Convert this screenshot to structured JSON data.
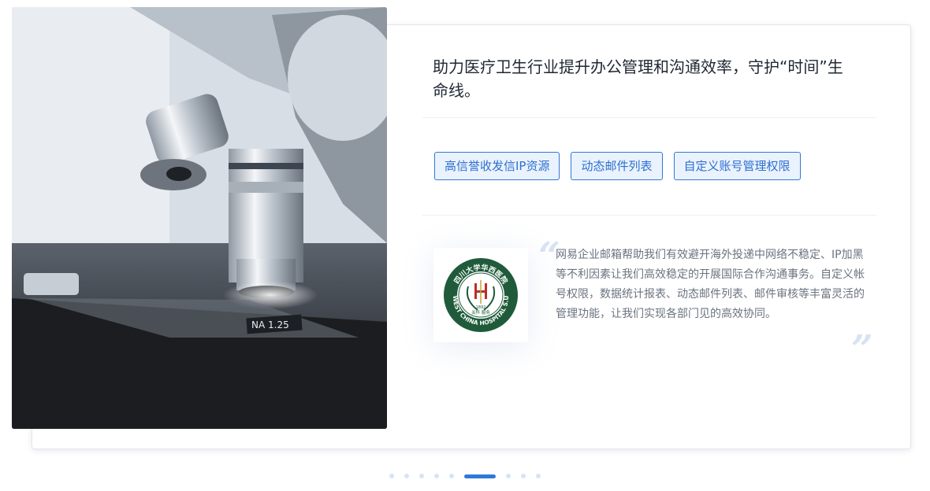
{
  "headline": "助力医疗卫生行业提升办公管理和沟通效率，守护“时间”生命线。",
  "tags": [
    "高信誉收发信IP资源",
    "动态邮件列表",
    "自定义账号管理权限"
  ],
  "quote": "网易企业邮箱帮助我们有效避开海外投递中网络不稳定、IP加黑等不利因素让我们高效稳定的开展国际合作沟通事务。自定义帐号权限，数据统计报表、动态邮件列表、邮件审核等丰富灵活的管理功能，让我们实现各部门见的高效协同。",
  "quote_open": "“",
  "quote_close": "”",
  "logo": {
    "text_top": "四川大学华西医院",
    "text_bottom": "WEST CHINA HOSPITAL S.U",
    "year": "1892",
    "motto": "关怀  服务",
    "color": "#1f5b3a"
  },
  "photo": {
    "objective_label": "NA 1.25"
  },
  "pagination": {
    "count": 9,
    "active_index": 5
  },
  "colors": {
    "accent": "#2f79d8",
    "tag_bg": "#eaf3fd"
  }
}
